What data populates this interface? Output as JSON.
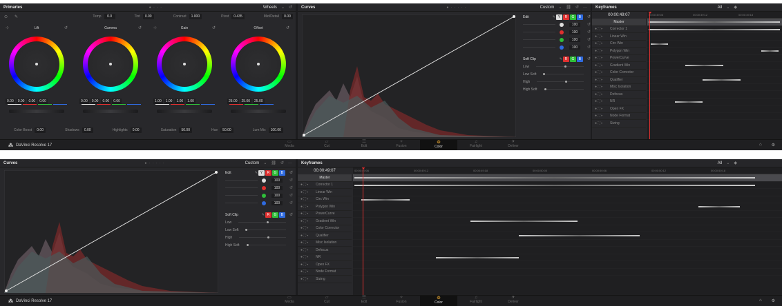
{
  "top": {
    "primaries": {
      "title": "Primaries",
      "mode": "Wheels",
      "temp_label": "Temp",
      "temp": "0.0",
      "tint_label": "Tint",
      "tint": "0.00",
      "contrast_label": "Contrast",
      "contrast": "1.000",
      "pivot_label": "Pivot",
      "pivot": "0.435",
      "middetail_label": "Mid/Detail",
      "middetail": "0.00",
      "wheels": [
        {
          "name": "Lift",
          "values": [
            "0.00",
            "0.00",
            "0.00",
            "0.00"
          ]
        },
        {
          "name": "Gamma",
          "values": [
            "0.00",
            "0.00",
            "0.00",
            "0.00"
          ]
        },
        {
          "name": "Gain",
          "values": [
            "1.00",
            "1.00",
            "1.00",
            "1.00"
          ]
        },
        {
          "name": "Offset",
          "values": [
            "25.00",
            "25.00",
            "25.00"
          ]
        }
      ],
      "color_boost_label": "Color Boost",
      "color_boost": "0.00",
      "shadows_label": "Shadows",
      "shadows": "0.00",
      "highlights_label": "Highlights",
      "highlights": "0.00",
      "saturation_label": "Saturation",
      "saturation": "50.00",
      "hue_label": "Hue",
      "hue": "50.00",
      "lummix_label": "Lum Mix",
      "lummix": "100.00"
    },
    "curves": {
      "title": "Curves",
      "preset": "Custom"
    },
    "keyframes": {
      "title": "Keyframes",
      "filter": "All",
      "timecode": "00:00:49:07",
      "ruler": [
        "00:00:49:06",
        "00:00:49:12",
        "00:00:49:18"
      ]
    }
  },
  "bottom": {
    "curves": {
      "title": "Curves",
      "preset": "Custom"
    },
    "keyframes": {
      "title": "Keyframes",
      "filter": "All",
      "timecode": "00:00:49:07",
      "ruler": [
        "00:00:49:06",
        "00:00:49:12",
        "00:00:49:18",
        "00:00:50:00",
        "00:00:50:06",
        "00:00:50:12",
        "00:00:50:18"
      ]
    }
  },
  "edit": {
    "label": "Edit",
    "channels": [
      {
        "color": "#dddddd",
        "value": "100"
      },
      {
        "color": "#e0302f",
        "value": "100"
      },
      {
        "color": "#2fbf3a",
        "value": "100"
      },
      {
        "color": "#2f6be0",
        "value": "100"
      }
    ],
    "channel_buttons": [
      "Y",
      "R",
      "G",
      "B"
    ]
  },
  "soft_clip": {
    "label": "Soft Clip",
    "rows": [
      "Low",
      "Low Soft",
      "High",
      "High Soft"
    ]
  },
  "kf_rows": [
    "Master",
    "Corrector 1",
    "Linear Win",
    "Circ Win",
    "Polygon Win",
    "PowerCurve",
    "Gradient Win",
    "Color Corrector",
    "Qualifier",
    "Misc Isolation",
    "Defocus",
    "NR",
    "Open FX",
    "Node Format",
    "Sizing"
  ],
  "app": {
    "name": "DaVinci Resolve 17"
  },
  "pages": [
    "Media",
    "Cut",
    "Edit",
    "Fusion",
    "Color",
    "Fairlight",
    "Deliver"
  ],
  "page_icons": [
    "media-icon",
    "cut-icon",
    "edit-icon",
    "fusion-icon",
    "color-icon",
    "fairlight-icon",
    "deliver-icon"
  ],
  "active_page": "Color"
}
